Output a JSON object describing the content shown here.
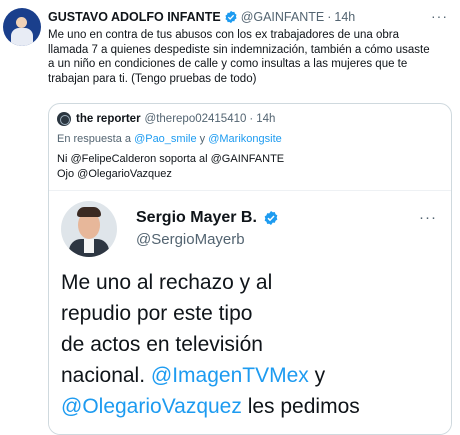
{
  "tweet": {
    "author_name": "GUSTAVO ADOLFO INFANTE",
    "handle": "@GAINFANTE",
    "separator": "·",
    "time": "14h",
    "more_glyph": "···",
    "line1": "Me uno en contra de tus abusos con los ex trabajadores de una obra",
    "line2": "llamada 7 a quienes despediste sin indemnización, también a cómo usaste",
    "line3": "a un niño en condiciones de calle y como insultas a las mujeres que te",
    "line4": "trabajan para ti. (Tengo pruebas de todo)"
  },
  "quote": {
    "author_name": "the reporter",
    "handle": "@therepo02415410",
    "separator": "·",
    "time": "14h",
    "reply_prefix": "En respuesta a",
    "reply_mention1": "@Pao_smile",
    "reply_joiner": "y",
    "reply_mention2": "@Marikongsite",
    "text_line1": "Ni @FelipeCalderon soporta al @GAINFANTE",
    "text_line2": "Ojo @OlegarioVazquez"
  },
  "embedded": {
    "author_name": "Sergio Mayer B.",
    "handle": "@SergioMayerb",
    "more_glyph": "···",
    "line1": "Me uno al rechazo y al",
    "line2": "repudio por este tipo",
    "line3": "de actos en televisión",
    "line4_prefix": "nacional.",
    "line4_mention": "@ImagenTVMex",
    "line4_suffix": "y",
    "line5_mention": "@OlegarioVazquez",
    "line5_suffix": "les pedimos"
  },
  "colors": {
    "link": "#1d9bf0",
    "secondary_text": "#536471",
    "verified": "#1d9bf0"
  }
}
